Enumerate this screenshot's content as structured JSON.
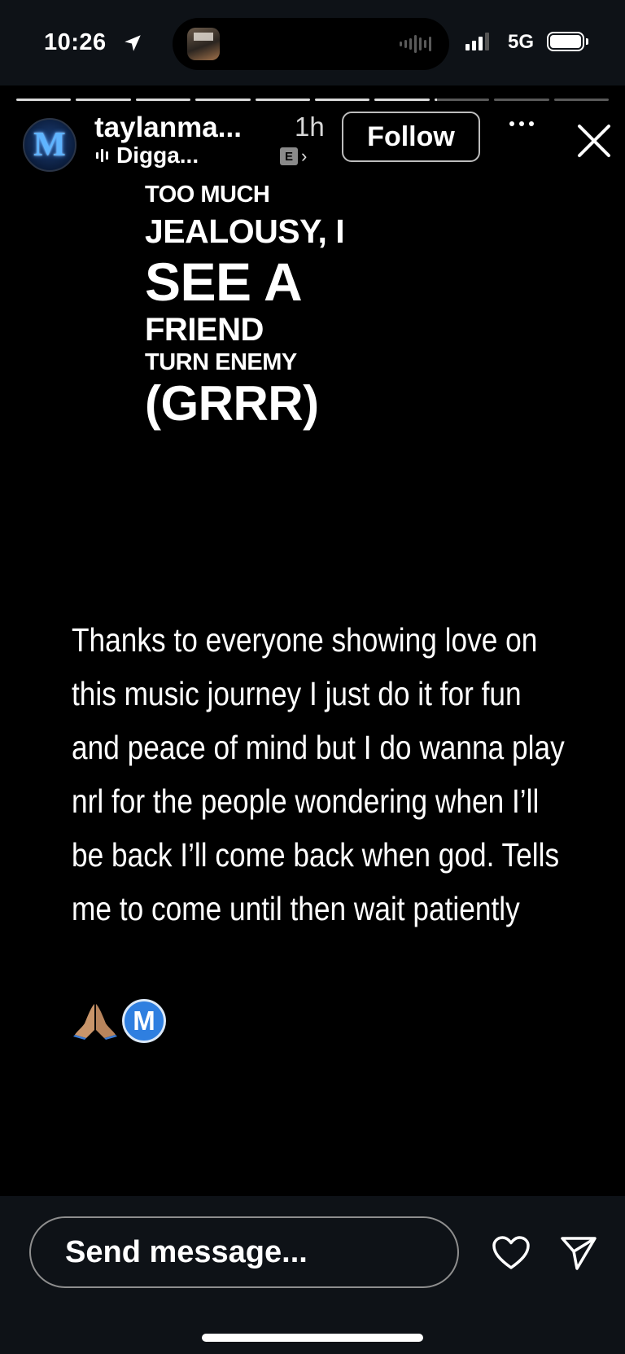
{
  "status_bar": {
    "time": "10:26",
    "network": "5G",
    "signal_bars_active": 3,
    "icons": [
      "location-arrow-icon",
      "waveform-icon",
      "signal-icon",
      "battery-icon"
    ]
  },
  "story": {
    "progress": {
      "segments_total": 10,
      "segments_done": 7,
      "current_segment_fraction": 0.05
    },
    "header": {
      "username": "taylanma...",
      "time_ago": "1h",
      "song": "Digga...",
      "explicit_badge": "E",
      "follow_label": "Follow"
    },
    "lyrics": [
      "TOO MUCH",
      "JEALOUSY, I",
      "SEE A",
      "FRIEND",
      "TURN ENEMY",
      "(GRRR)"
    ],
    "caption_lines": [
      "Thanks to everyone showing love on",
      "this music journey I just do it for fun",
      "and peace of mind but I do wanna play",
      "nrl for the people wondering when I’ll",
      "be back I’ll come back when god. Tells",
      "me to come until then wait patiently"
    ],
    "emoji_badge_letter": "M"
  },
  "bottom_bar": {
    "message_placeholder": "Send message..."
  },
  "colors": {
    "background": "#000000",
    "chrome": "#0e1217",
    "text": "#ffffff",
    "badge_blue": "#2f7fe0"
  }
}
